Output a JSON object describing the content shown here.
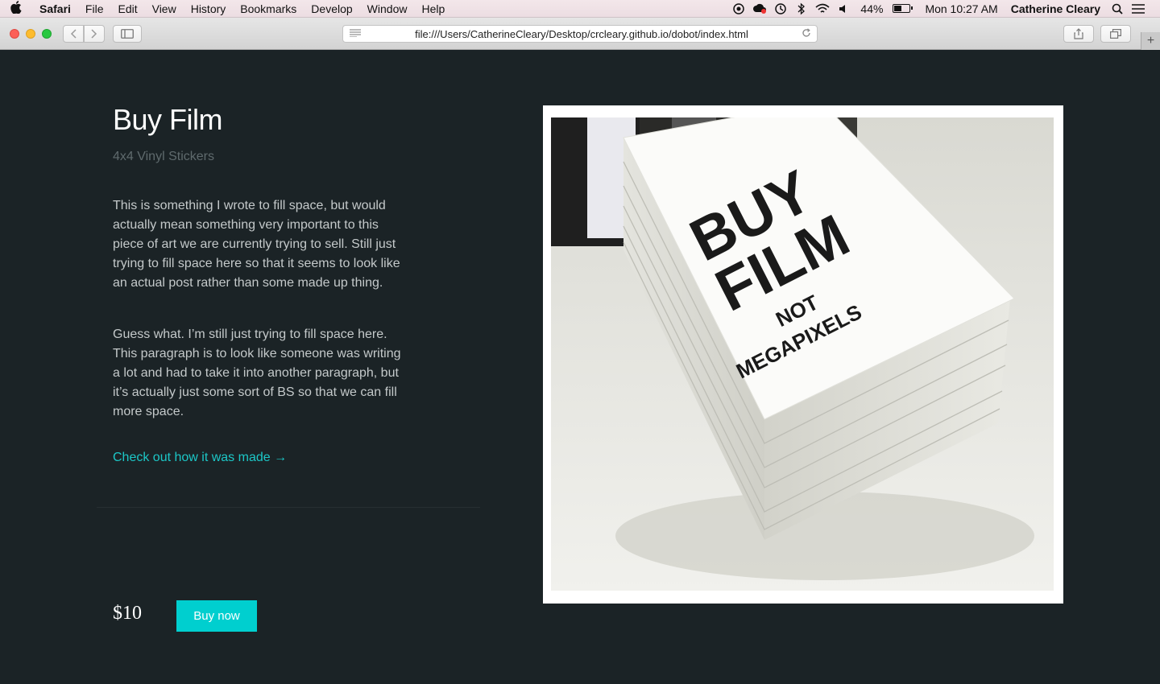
{
  "menubar": {
    "app": "Safari",
    "items": [
      "File",
      "Edit",
      "View",
      "History",
      "Bookmarks",
      "Develop",
      "Window",
      "Help"
    ],
    "battery": "44%",
    "clock": "Mon 10:27 AM",
    "user": "Catherine Cleary"
  },
  "browser": {
    "url": "file:///Users/CatherineCleary/Desktop/crcleary.github.io/dobot/index.html"
  },
  "product": {
    "title": "Buy Film",
    "subtitle": "4x4 Vinyl Stickers",
    "paragraph1": "This is something I wrote to fill space, but would actually mean something very important to this piece of art we are currently trying to sell. Still just trying to fill space here so that it seems to look like an actual post rather than some made up thing.",
    "paragraph2": "Guess what. I’m still just trying to fill space here. This paragraph is to look like someone was writing a lot and had to take it into another paragraph, but it’s actually just some sort of BS so that we can fill more space.",
    "made_link": "Check out how it was made →",
    "price": "$10",
    "buy_label": "Buy now"
  },
  "sticker": {
    "line1": "BUY",
    "line2": "FILM",
    "line3": "NOT",
    "line4": "MEGAPIXELS"
  },
  "colors": {
    "page_bg": "#1b2326",
    "accent": "#00cfcf",
    "link": "#1cc7c7"
  }
}
